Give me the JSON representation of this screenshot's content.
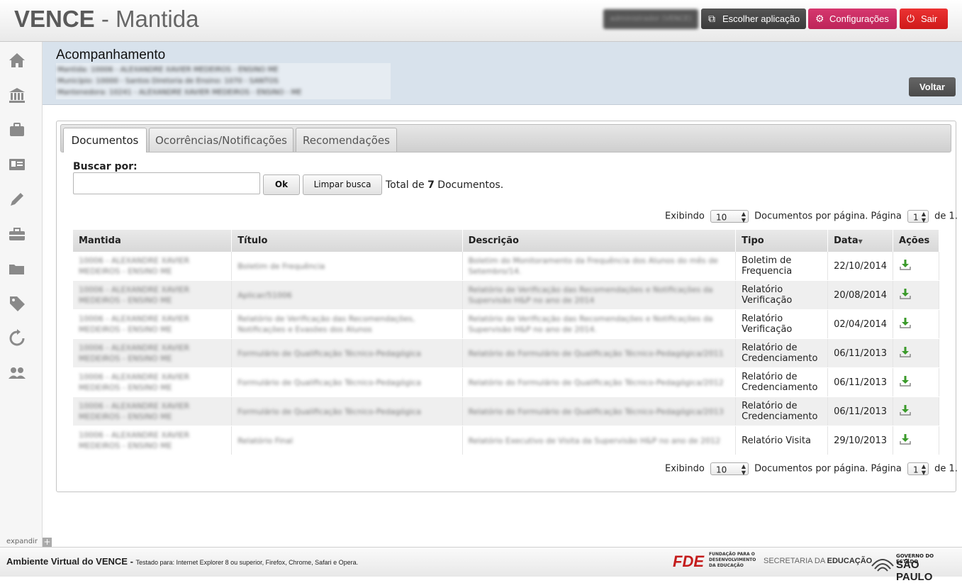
{
  "header": {
    "brand_strong": "VENCE",
    "brand_rest": " - Mantida",
    "user_label": "administrador (VENCE)",
    "buttons": {
      "app": "Escolher aplicação",
      "config": "Configurações",
      "logout": "Sair"
    }
  },
  "sidebar": {
    "icons": [
      "home-icon",
      "bank-icon",
      "briefcase-icon",
      "id-card-icon",
      "pencil-icon",
      "toolbox-icon",
      "folder-icon",
      "tag-icon",
      "refresh-icon",
      "users-icon"
    ],
    "expand_label": "expandir"
  },
  "page": {
    "title": "Acompanhamento",
    "info_lines": [
      "Mantida: 10006 - ALEXANDRE XAVIER MEDEIROS - ENSINO ME",
      "Município: 10000 - Santos Diretoria de Ensino: 1070 - SANTOS",
      "Mantenedora: 10241 - ALEXANDRE XAVIER MEDEIROS - ENSINO - ME"
    ],
    "back_button": "Voltar"
  },
  "tabs": [
    "Documentos",
    "Ocorrências/Notificações",
    "Recomendações"
  ],
  "search": {
    "label": "Buscar por:",
    "value": "",
    "ok_button": "Ok",
    "clear_button": "Limpar busca",
    "total_prefix": "Total de ",
    "total_count": "7",
    "total_suffix": " Documentos."
  },
  "pager": {
    "showing": "Exibindo",
    "per_page_value": "10",
    "per_page_text": "Documentos por página. Página",
    "page_value": "1",
    "of_text": "de 1."
  },
  "table": {
    "columns": [
      "Mantida",
      "Título",
      "Descrição",
      "Tipo",
      "Data",
      "Ações"
    ],
    "sorted_column": "Data",
    "rows": [
      {
        "mantida": "10006 - ALEXANDRE XAVIER MEDEIROS - ENSINO ME",
        "titulo": "Boletim de Frequência",
        "descricao": "Boletim do Monitoramento da Frequência dos Alunos do mês de Setembro/14.",
        "tipo": "Boletim de Frequencia",
        "data": "22/10/2014"
      },
      {
        "mantida": "10006 - ALEXANDRE XAVIER MEDEIROS - ENSINO ME",
        "titulo": "Aplicar/51006",
        "descricao": "Relatório de Verificação das Recomendações e Notificações da Supervisão H&P no ano de 2014",
        "tipo": "Relatório Verificação",
        "data": "20/08/2014"
      },
      {
        "mantida": "10006 - ALEXANDRE XAVIER MEDEIROS - ENSINO ME",
        "titulo": "Relatório de Verificação das Recomendações, Notificações e Evasões dos Alunos",
        "descricao": "Relatório de Verificação das Recomendações e Notificações da Supervisão H&P no ano de 2014.",
        "tipo": "Relatório Verificação",
        "data": "02/04/2014"
      },
      {
        "mantida": "10006 - ALEXANDRE XAVIER MEDEIROS - ENSINO ME",
        "titulo": "Formulário de Qualificação Técnico-Pedagógica",
        "descricao": "Relatório do Formulário de Qualificação Técnico-Pedagógica/2011",
        "tipo": "Relatório de Credenciamento",
        "data": "06/11/2013"
      },
      {
        "mantida": "10006 - ALEXANDRE XAVIER MEDEIROS - ENSINO ME",
        "titulo": "Formulário de Qualificação Técnico-Pedagógica",
        "descricao": "Relatório do Formulário de Qualificação Técnico-Pedagógica/2012",
        "tipo": "Relatório de Credenciamento",
        "data": "06/11/2013"
      },
      {
        "mantida": "10006 - ALEXANDRE XAVIER MEDEIROS - ENSINO ME",
        "titulo": "Formulário de Qualificação Técnico-Pedagógica",
        "descricao": "Relatório do Formulário de Qualificação Técnico-Pedagógica/2013",
        "tipo": "Relatório de Credenciamento",
        "data": "06/11/2013"
      },
      {
        "mantida": "10006 - ALEXANDRE XAVIER MEDEIROS - ENSINO ME",
        "titulo": "Relatório Final",
        "descricao": "Relatório Executivo de Visita da Supervisão H&P no ano de 2012",
        "tipo": "Relatório Visita",
        "data": "29/10/2013"
      }
    ]
  },
  "footer": {
    "title": "Ambiente Virtual do VENCE - ",
    "tested": "Testado para: Internet Explorer 8 ou superior, Firefox, Chrome, Safari e Opera.",
    "fde": "FDE",
    "fde_sub": [
      "FUNDAÇÃO PARA O",
      "DESENVOLVIMENTO",
      "DA EDUCAÇÃO"
    ],
    "secretaria_a": "SECRETARIA DA ",
    "secretaria_b": "EDUCAÇÃO",
    "gov_top": "GOVERNO DO ESTADO",
    "gov_main": "SÃO PAULO"
  },
  "colors": {
    "config": "#c92a63",
    "logout": "#e02424",
    "band": "#d8e2ec"
  }
}
